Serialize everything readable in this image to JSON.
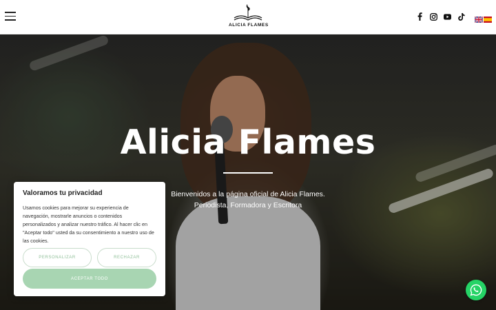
{
  "header": {
    "logo_text": "ALICIA FLAMES",
    "social_icons": [
      "facebook-icon",
      "instagram-icon",
      "youtube-icon",
      "tiktok-icon"
    ],
    "flags": [
      "uk-flag-icon",
      "spain-flag-icon"
    ]
  },
  "hero": {
    "title": "Alicia Flames",
    "subtitle_line1": "Bienvenidos a la página oficial de Alicia Flames.",
    "subtitle_line2": "Periodista, Formadora y Escritora"
  },
  "cookie": {
    "title": "Valoramos tu privacidad",
    "text": "Usamos cookies para mejorar su experiencia de navegación, mostrarle anuncios o contenidos personalizados y analizar nuestro tráfico. Al hacer clic en \"Aceptar todo\" usted da su consentimiento a nuestro uso de las cookies.",
    "customize_label": "PERSONALIZAR",
    "reject_label": "RECHAZAR",
    "accept_label": "ACEPTAR TODO"
  },
  "colors": {
    "accent": "#a8d5b2",
    "whatsapp": "#25d366"
  },
  "whatsapp": {
    "icon": "whatsapp-icon"
  }
}
